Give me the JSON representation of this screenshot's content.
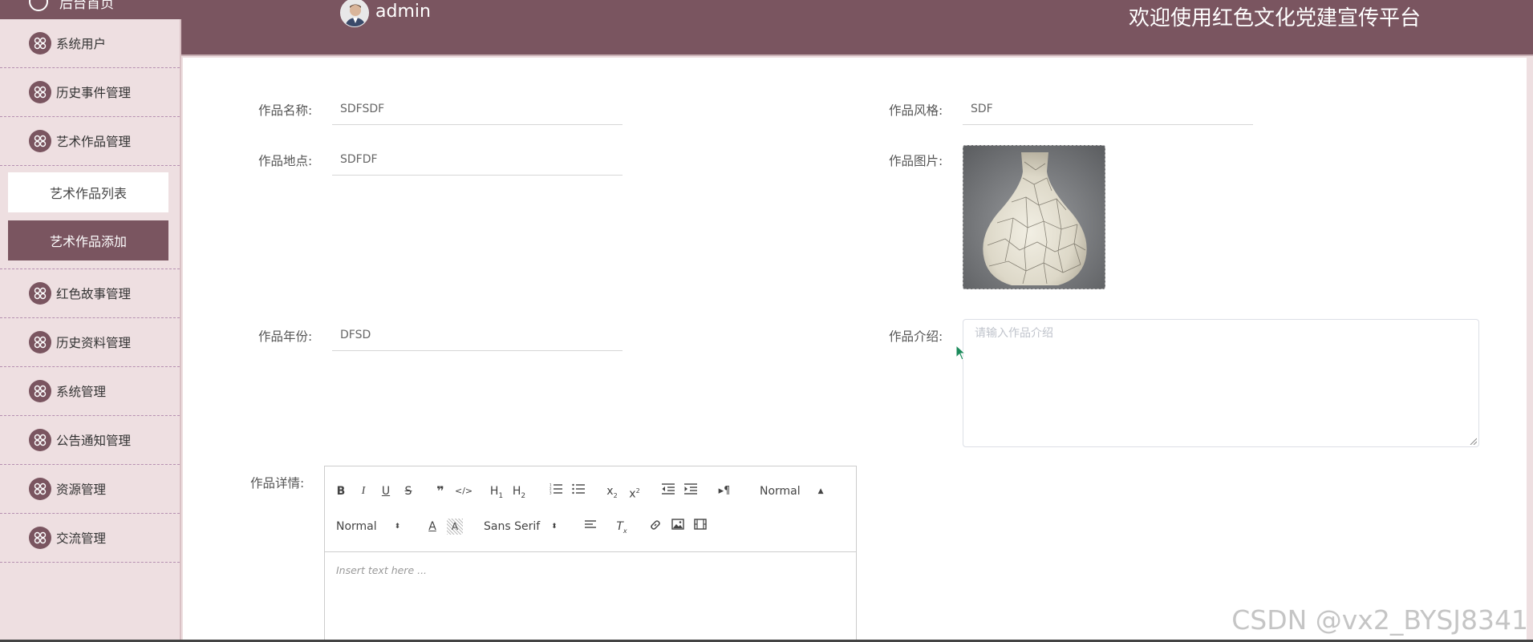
{
  "sidebar": {
    "head_label": "后台首页",
    "items": [
      {
        "label": "系统用户"
      },
      {
        "label": "历史事件管理"
      },
      {
        "label": "艺术作品管理"
      }
    ],
    "sub_items": [
      {
        "label": "艺术作品列表"
      },
      {
        "label": "艺术作品添加"
      }
    ],
    "items_after": [
      {
        "label": "红色故事管理"
      },
      {
        "label": "历史资料管理"
      },
      {
        "label": "系统管理"
      },
      {
        "label": "公告通知管理"
      },
      {
        "label": "资源管理"
      },
      {
        "label": "交流管理"
      }
    ]
  },
  "header": {
    "user_name": "admin",
    "welcome": "欢迎使用红色文化党建宣传平台"
  },
  "form": {
    "name_label": "作品名称:",
    "name_value": "SDFSDF",
    "style_label": "作品风格:",
    "style_value": "SDF",
    "place_label": "作品地点:",
    "place_value": "SDFDF",
    "image_label": "作品图片:",
    "year_label": "作品年份:",
    "year_value": "DFSD",
    "intro_label": "作品介绍:",
    "intro_placeholder": "请输入作品介绍",
    "detail_label": "作品详情:"
  },
  "editor": {
    "header_select": "Normal",
    "size_select": "Normal",
    "font_select": "Sans Serif",
    "placeholder": "Insert text here ..."
  },
  "watermark": "CSDN @vx2_BYSJ8341",
  "colors": {
    "brand": "#7a5560",
    "sidebar_bg": "#eedfe1"
  }
}
